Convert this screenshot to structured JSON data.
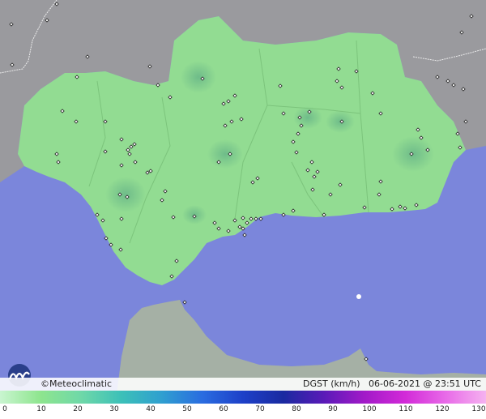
{
  "brand": {
    "logo_icon": "meteoclimatic-logo-icon",
    "name": "©Meteoclimatic"
  },
  "stamp": {
    "variable": "DGST",
    "unit": "(km/h)",
    "date": "06-06-2021",
    "at": "@",
    "time": "23:51 UTC"
  },
  "colors": {
    "sea": "#7b86db",
    "land_other": "#9a9a9e",
    "land_region": "#92dc92",
    "station_marker": "#222222"
  },
  "legend": {
    "scale_min": 0,
    "scale_max": 130,
    "ticks": [
      "0",
      "10",
      "20",
      "30",
      "40",
      "50",
      "60",
      "70",
      "80",
      "90",
      "100",
      "110",
      "120",
      "130"
    ],
    "ramp_colors": [
      "#c9f5d0",
      "#8ee58e",
      "#6fd8a8",
      "#3cc0b8",
      "#2f9fd0",
      "#2a6ce0",
      "#1d40c8",
      "#1a2aa0",
      "#5a1ab8",
      "#a21ac8",
      "#d22ad8",
      "#e86ae8",
      "#f5b2f0"
    ]
  }
}
